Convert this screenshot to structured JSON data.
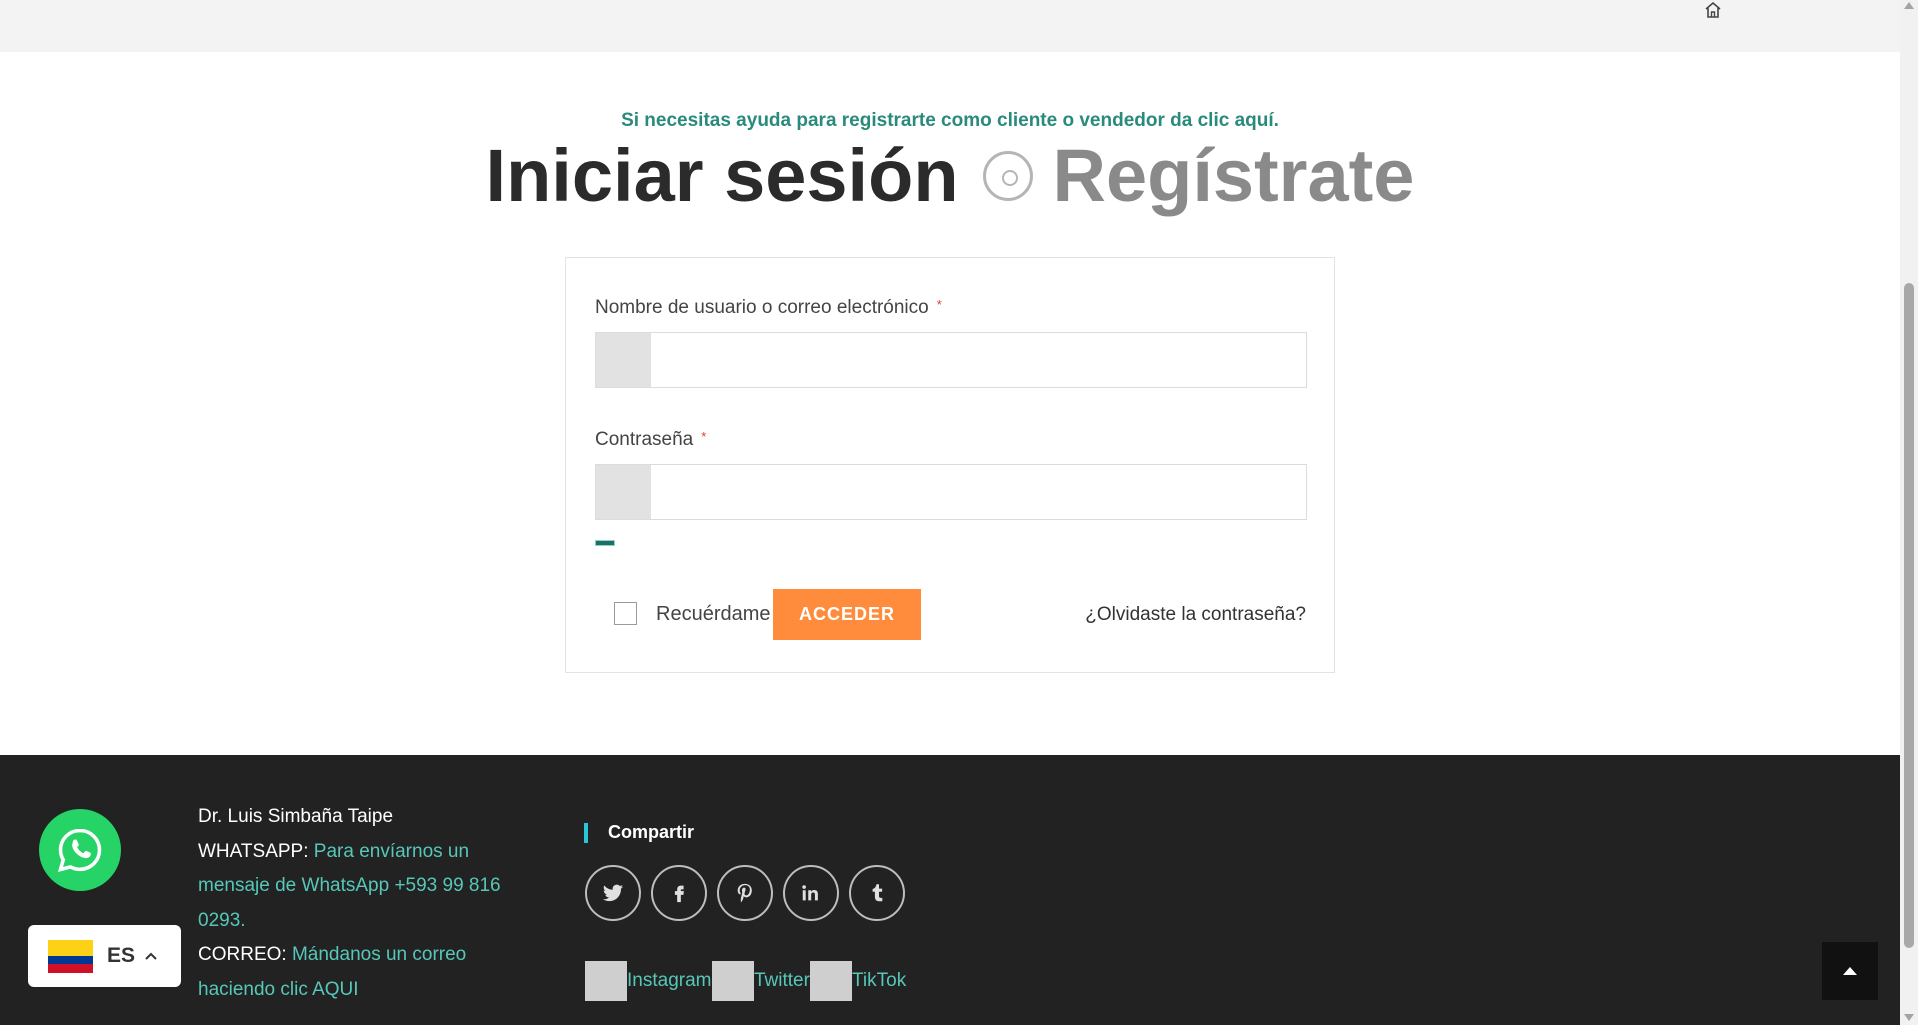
{
  "header": {
    "home_icon": "home-icon"
  },
  "help": {
    "text": "Si necesitas ayuda para registrarte como cliente o vendedor da clic aquí."
  },
  "tabs": {
    "login": "Iniciar sesión",
    "register": "Regístrate"
  },
  "form": {
    "username_label": "Nombre de usuario o correo electrónico",
    "password_label": "Contraseña",
    "required_mark": "*",
    "username_value": "",
    "password_value": "",
    "remember_label": "Recuérdame",
    "submit_label": "ACCEDER",
    "forgot_label": "¿Olvidaste la contraseña?"
  },
  "footer": {
    "name": "Dr. Luis Simbaña Taipe",
    "whatsapp_label": "WHATSAPP:",
    "whatsapp_link": "Para envíarnos un mensaje de WhatsApp +593 99 816 0293.",
    "email_label": "CORREO:",
    "email_link": "Mándanos un correo haciendo clic AQUI",
    "share_title": "Compartir",
    "social_icons": [
      "twitter-icon",
      "facebook-icon",
      "pinterest-icon",
      "linkedin-icon",
      "tumblr-icon"
    ],
    "links": [
      "Instagram",
      "Twitter",
      "TikTok"
    ]
  },
  "language": {
    "code": "ES"
  },
  "colors": {
    "accent_green": "#2a8a7c",
    "link_teal": "#56c7b8",
    "button_orange": "#ff8c3d",
    "footer_bg": "#222222",
    "whatsapp_green": "#25d366"
  }
}
